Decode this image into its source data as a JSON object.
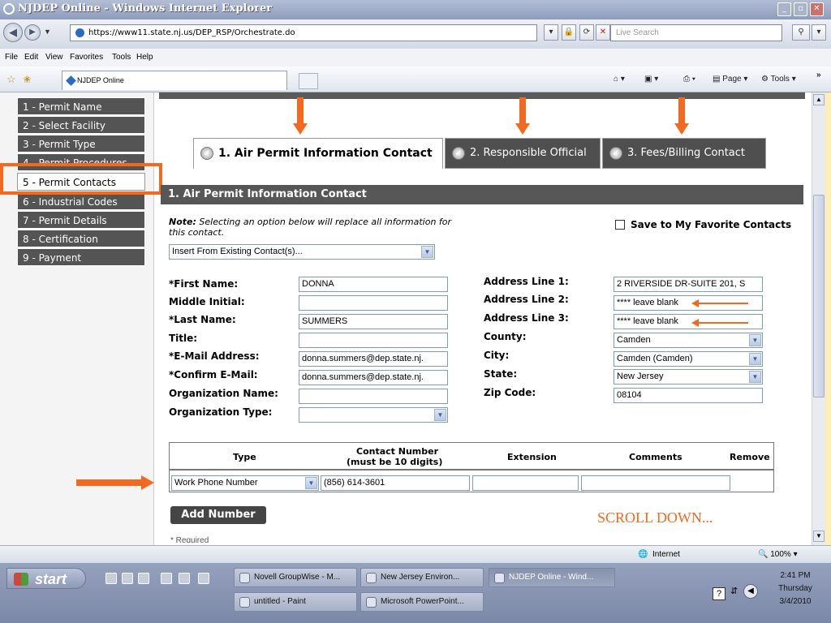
{
  "window": {
    "title": "NJDEP Online - Windows Internet Explorer"
  },
  "browser": {
    "url": "https://www11.state.nj.us/DEP_RSP/Orchestrate.do",
    "search_placeholder": "Live Search",
    "menu": [
      "File",
      "Edit",
      "View",
      "Favorites",
      "Tools",
      "Help"
    ],
    "tab_title": "NJDEP Online",
    "page_label": "Page",
    "tools_label": "Tools"
  },
  "sidebar": {
    "items": [
      {
        "label": "1 - Permit Name"
      },
      {
        "label": "2 - Select Facility"
      },
      {
        "label": "3 - Permit Type"
      },
      {
        "label": "4 - Permit Procedures"
      },
      {
        "label": "5 - Permit Contacts"
      },
      {
        "label": "6 - Industrial Codes"
      },
      {
        "label": "7 - Permit Details"
      },
      {
        "label": "8 - Certification"
      },
      {
        "label": "9 - Payment"
      }
    ]
  },
  "tabs": [
    {
      "label": "1. Air Permit Information Contact",
      "active": true
    },
    {
      "label": "2. Responsible Official",
      "active": false
    },
    {
      "label": "3. Fees/Billing Contact",
      "active": false
    }
  ],
  "section": {
    "title": "1. Air Permit Information Contact"
  },
  "note": {
    "bold": "Note:",
    "text": "Selecting an option below will replace all information for this contact."
  },
  "favorite_label": "Save to My Favorite Contacts",
  "existing_contact_select": "Insert From Existing Contact(s)...",
  "form": {
    "first_name_label": "*First Name:",
    "first_name_value": "DONNA",
    "middle_initial_label": "Middle Initial:",
    "middle_initial_value": "",
    "last_name_label": "*Last Name:",
    "last_name_value": "SUMMERS",
    "title_label": "Title:",
    "title_value": "",
    "email_label": "*E-Mail Address:",
    "email_value": "donna.summers@dep.state.nj.",
    "confirm_email_label": "*Confirm E-Mail:",
    "confirm_email_value": "donna.summers@dep.state.nj.",
    "org_name_label": "Organization Name:",
    "org_name_value": "",
    "org_type_label": "Organization Type:",
    "org_type_value": "",
    "address1_label": "Address Line 1:",
    "address1_value": "2 RIVERSIDE DR-SUITE 201, S",
    "address2_label": "Address Line 2:",
    "address2_value": "**** leave blank",
    "address3_label": "Address Line 3:",
    "address3_value": "**** leave blank",
    "county_label": "County:",
    "county_value": "Camden",
    "city_label": "City:",
    "city_value": "Camden (Camden)",
    "state_label": "State:",
    "state_value": "New Jersey",
    "zip_label": "Zip Code:",
    "zip_value": "08104"
  },
  "phone_table": {
    "headers": {
      "type": "Type",
      "number_line1": "Contact Number",
      "number_line2": "(must be 10 digits)",
      "extension": "Extension",
      "comments": "Comments",
      "remove": "Remove"
    },
    "row": {
      "type": "Work Phone Number",
      "number": "(856) 614-3601",
      "extension": "",
      "comments": ""
    }
  },
  "add_number_label": "Add Number",
  "scroll_down_text": "SCROLL DOWN...",
  "required_text": "* Required",
  "status": {
    "zone": "Internet",
    "zoom": "100%"
  },
  "taskbar": {
    "start_label": "start",
    "buttons": [
      {
        "label": "Novell GroupWise - M..."
      },
      {
        "label": "New Jersey Environ..."
      },
      {
        "label": "NJDEP Online - Wind..."
      },
      {
        "label": "untitled - Paint"
      },
      {
        "label": "Microsoft PowerPoint..."
      }
    ],
    "clock": {
      "time": "2:41 PM",
      "day": "Thursday",
      "date": "3/4/2010"
    }
  },
  "colors": {
    "accent_orange": "#f26a21",
    "tab_dark": "#4f4f4f",
    "sidebar_dark": "#545454"
  }
}
